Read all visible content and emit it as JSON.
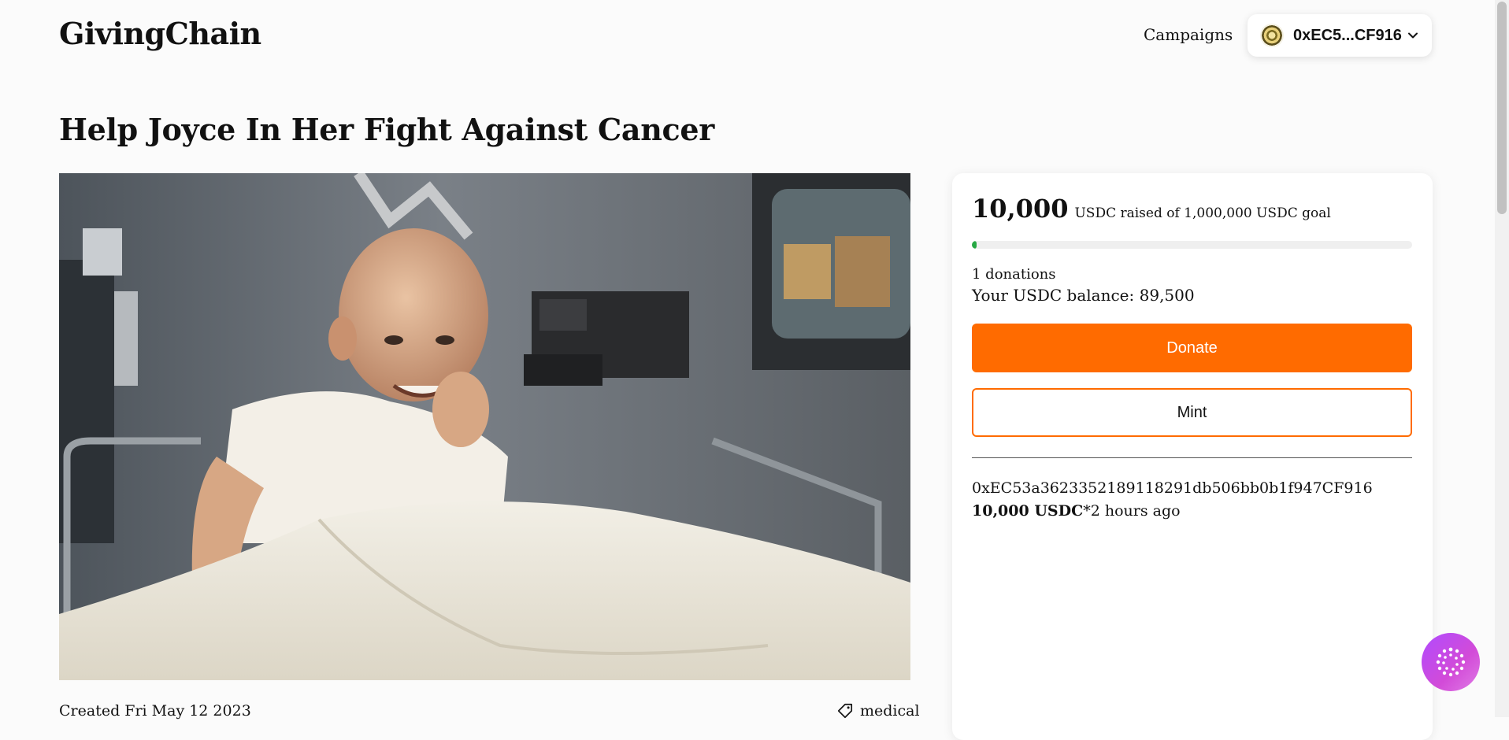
{
  "header": {
    "logo": "GivingChain",
    "nav_campaigns": "Campaigns",
    "wallet_address": "0xEC5...CF916"
  },
  "campaign": {
    "title": "Help Joyce In Her Fight Against Cancer",
    "created": "Created Fri May 12 2023",
    "tag": "medical"
  },
  "donation_panel": {
    "raised_amount": "10,000",
    "raised_suffix": "USDC raised of 1,000,000 USDC goal",
    "progress_fraction": 0.01,
    "donations_count": "1 donations",
    "balance": "Your USDC balance: 89,500",
    "donate_label": "Donate",
    "mint_label": "Mint",
    "donations": [
      {
        "address": "0xEC53a3623352189118291db506bb0b1f947CF916",
        "amount": "10,000 USDC",
        "time": "*2 hours ago"
      }
    ]
  },
  "colors": {
    "accent": "#ff6b00",
    "progress": "#27a844",
    "fab": "#c44be8"
  },
  "icons": {
    "wallet_avatar": "wallet-avatar-icon",
    "dropdown": "chevron-down-icon",
    "tag": "tag-icon",
    "assistant": "assistant-orb-icon"
  }
}
